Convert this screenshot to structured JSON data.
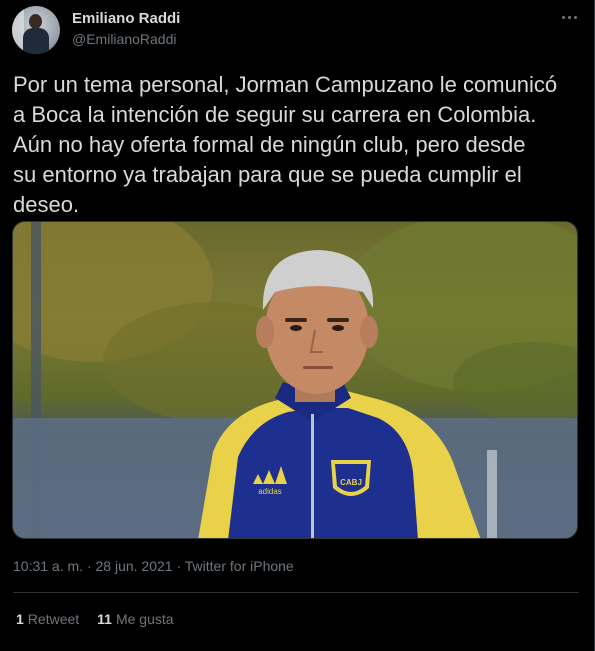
{
  "author": {
    "name": "Emiliano Raddi",
    "handle": "@EmilianoRaddi",
    "avatar_icon": "profile-photo"
  },
  "tweet": {
    "text": "Por un tema personal, Jorman Campuzano le comunicó\na Boca la intención de seguir su carrera en Colombia.\nAún no hay oferta formal de ningún club, pero desde\nsu entorno ya trabajan para que se pueda cumplir el\ndeseo.",
    "image_caption_badge": "CABJ",
    "image_brand": "adidas"
  },
  "meta": {
    "time": "10:31 a. m.",
    "separator": "·",
    "date": "28 jun. 2021",
    "source": "Twitter for iPhone"
  },
  "stats": {
    "retweets_count": "1",
    "retweets_label": "Retweet",
    "likes_count": "11",
    "likes_label": "Me gusta"
  },
  "colors": {
    "background": "#000000",
    "text": "#d9d9d9",
    "secondary": "#6e767d",
    "border": "#2f3336"
  }
}
